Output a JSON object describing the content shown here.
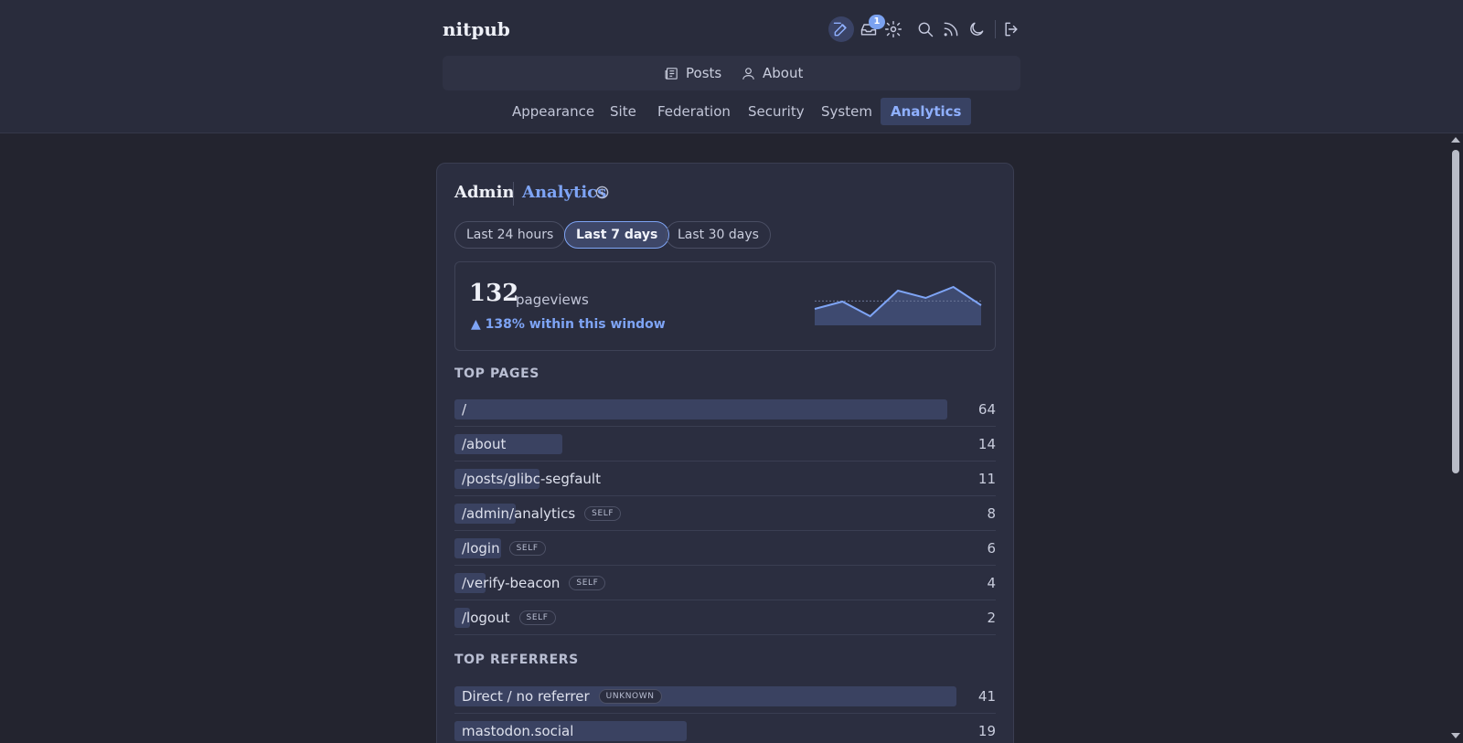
{
  "site": {
    "title": "nitpub"
  },
  "header": {
    "notification_count": "1",
    "icons": [
      "compose-icon",
      "inbox-icon",
      "gear-icon",
      "search-icon",
      "rss-icon",
      "moon-icon",
      "logout-icon"
    ]
  },
  "nav": {
    "posts_label": "Posts",
    "about_label": "About"
  },
  "admin_nav": {
    "items": [
      {
        "label": "Appearance"
      },
      {
        "label": "Site"
      },
      {
        "label": "Federation"
      },
      {
        "label": "Security"
      },
      {
        "label": "System"
      },
      {
        "label": "Analytics",
        "active": true
      }
    ]
  },
  "page": {
    "breadcrumb_root": "Admin",
    "breadcrumb_current": "Analytics"
  },
  "ranges": [
    {
      "label": "Last 24 hours"
    },
    {
      "label": "Last 7 days",
      "active": true
    },
    {
      "label": "Last 30 days"
    }
  ],
  "summary": {
    "pageviews": "132",
    "unit": "pageviews",
    "delta": "▲ 138% within this window"
  },
  "chart_data": {
    "type": "area",
    "values": [
      3,
      5,
      1,
      8,
      6,
      9,
      4
    ],
    "ylim": [
      0,
      10
    ]
  },
  "top_pages": {
    "title": "TOP PAGES",
    "rows": [
      {
        "path": "/",
        "count": "64",
        "tag": ""
      },
      {
        "path": "/about",
        "count": "14",
        "tag": ""
      },
      {
        "path": "/posts/glibc-segfault",
        "count": "11",
        "tag": ""
      },
      {
        "path": "/admin/analytics",
        "count": "8",
        "tag": "SELF"
      },
      {
        "path": "/login",
        "count": "6",
        "tag": "SELF"
      },
      {
        "path": "/verify-beacon",
        "count": "4",
        "tag": "SELF"
      },
      {
        "path": "/logout",
        "count": "2",
        "tag": "SELF"
      }
    ]
  },
  "top_referrers": {
    "title": "TOP REFERRERS",
    "rows": [
      {
        "path": "Direct / no referrer",
        "count": "41",
        "tag": "UNKNOWN"
      },
      {
        "path": "mastodon.social",
        "count": "19",
        "tag": ""
      }
    ]
  },
  "colors": {
    "accent": "#7ea4f5",
    "background": "#23242f",
    "card": "#2b2e40",
    "bar": "#3a4261"
  }
}
